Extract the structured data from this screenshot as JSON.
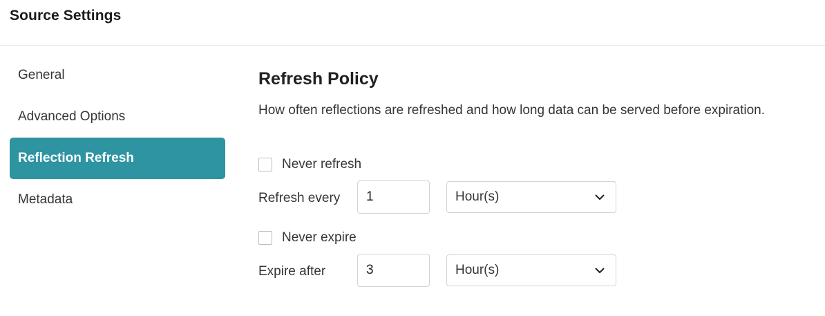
{
  "header": {
    "title": "Source Settings"
  },
  "sidebar": {
    "items": [
      {
        "label": "General",
        "active": false
      },
      {
        "label": "Advanced Options",
        "active": false
      },
      {
        "label": "Reflection Refresh",
        "active": true
      },
      {
        "label": "Metadata",
        "active": false
      }
    ]
  },
  "colors": {
    "accent": "#2e94a1"
  },
  "refresh_policy": {
    "title": "Refresh Policy",
    "description": "How often reflections are refreshed and how long data can be served before expiration.",
    "never_refresh": {
      "label": "Never refresh",
      "checked": false
    },
    "refresh_every": {
      "label": "Refresh every",
      "value": "1",
      "unit": "Hour(s)"
    },
    "never_expire": {
      "label": "Never expire",
      "checked": false
    },
    "expire_after": {
      "label": "Expire after",
      "value": "3",
      "unit": "Hour(s)"
    }
  },
  "icons": {
    "select_arrow": "chevron-down-icon"
  }
}
